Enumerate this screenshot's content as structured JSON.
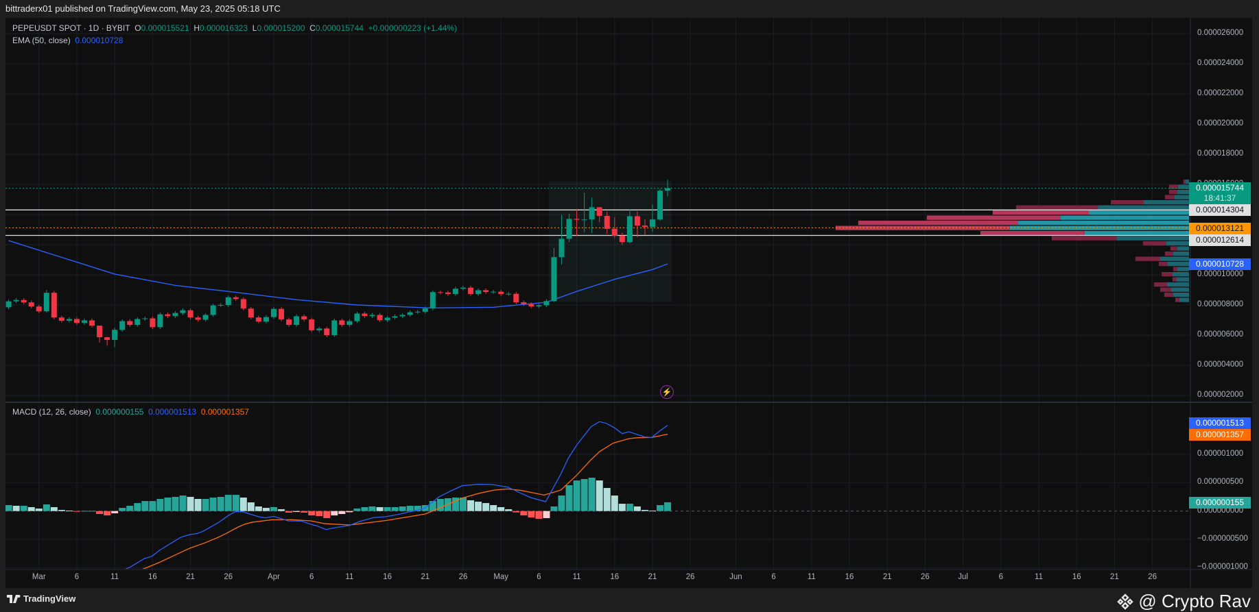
{
  "header": {
    "published": "bittraderx01 published on TradingView.com, May 23, 2025 05:18 UTC"
  },
  "legend": {
    "symbol": "PEPEUSDT SPOT · 1D · BYBIT",
    "o_label": "O",
    "o": "0.000015521",
    "h_label": "H",
    "h": "0.000016323",
    "l_label": "L",
    "l": "0.000015200",
    "c_label": "C",
    "c": "0.000015744",
    "change": "+0.000000223 (+1.44%)",
    "ema_label": "EMA (50, close)",
    "ema_value": "0.000010728",
    "macd_label": "MACD (12, 26, close)",
    "macd_hist": "0.000000155",
    "macd_line": "0.000001513",
    "macd_signal": "0.000001357"
  },
  "markers": {
    "price": "0.000015744",
    "countdown": "18:41:37",
    "level_high": "0.000014304",
    "poc": "0.000013121",
    "level_low": "0.000012614",
    "ema": "0.000010728",
    "macd_line": "0.000001513",
    "macd_signal": "0.000001357",
    "macd_hist": "0.000000155"
  },
  "footer": {
    "brand": "TradingView",
    "watermark": "@ Crypto Rav"
  },
  "colors": {
    "up": "#089981",
    "down": "#f23645",
    "ema": "#2962ff",
    "signal": "#ff6d00",
    "poc": "#ff9800",
    "hist_up": "#26a69a",
    "hist_up_light": "#b2dfdb",
    "hist_down": "#ff5252",
    "hist_down_light": "#ffcdd2"
  },
  "chart_data": {
    "type": "candlestick",
    "symbol": "PEPEUSDT",
    "unit": "1e-6 USDT",
    "start_date": "2025-02-25",
    "first_open": 7.85,
    "closes": [
      8.24,
      8.33,
      8.17,
      7.9,
      7.58,
      8.81,
      7.17,
      6.95,
      7.07,
      6.81,
      6.98,
      6.63,
      5.86,
      5.68,
      6.35,
      6.93,
      6.68,
      7.07,
      7.11,
      6.53,
      7.38,
      7.26,
      7.47,
      7.65,
      7.17,
      7.02,
      7.34,
      7.97,
      8.0,
      8.51,
      8.39,
      7.76,
      7.17,
      6.9,
      7.2,
      7.74,
      7.04,
      6.68,
      7.25,
      7.04,
      6.32,
      6.44,
      6.0,
      6.98,
      6.68,
      6.93,
      7.43,
      7.26,
      7.34,
      6.99,
      7.16,
      7.25,
      7.34,
      7.52,
      7.55,
      7.77,
      8.85,
      8.83,
      8.73,
      9.08,
      9.15,
      8.73,
      8.98,
      8.86,
      8.88,
      8.73,
      8.74,
      8.18,
      8.05,
      7.91,
      7.98,
      8.26,
      11.17,
      12.39,
      13.71,
      13.65,
      13.67,
      14.48,
      13.91,
      13.05,
      12.59,
      12.17,
      13.89,
      13.27,
      13.18,
      13.67,
      15.58,
      15.744
    ],
    "wick_overrides": {
      "5": [
        9.0,
        7.5
      ],
      "12": [
        6.6,
        5.5
      ],
      "13": [
        5.9,
        5.3
      ],
      "14": [
        6.5,
        5.2
      ],
      "72": [
        11.79,
        8.2
      ],
      "73": [
        13.98,
        10.68
      ],
      "74": [
        14.06,
        12.17
      ],
      "75": [
        14.32,
        12.58
      ],
      "76": [
        15.45,
        12.82
      ],
      "77": [
        15.12,
        12.77
      ],
      "78": [
        14.5,
        13.48
      ],
      "79": [
        14.2,
        12.73
      ],
      "80": [
        13.83,
        12.45
      ],
      "81": [
        12.8,
        11.98
      ],
      "82": [
        14.32,
        12.1
      ],
      "83": [
        14.2,
        12.5
      ],
      "84": [
        13.67,
        12.67
      ],
      "85": [
        14.67,
        12.85
      ],
      "86": [
        15.7,
        13.6
      ],
      "87": [
        16.323,
        15.2
      ]
    },
    "ema50": [
      [
        0,
        12.27
      ],
      [
        8,
        11.0
      ],
      [
        14,
        10.05
      ],
      [
        22,
        9.3
      ],
      [
        30,
        8.84
      ],
      [
        38,
        8.35
      ],
      [
        46,
        8.0
      ],
      [
        56,
        7.8
      ],
      [
        64,
        7.85
      ],
      [
        71,
        8.18
      ],
      [
        75,
        8.9
      ],
      [
        80,
        9.7
      ],
      [
        85,
        10.35
      ],
      [
        87,
        10.728
      ]
    ],
    "levels": {
      "resistance": 14.304,
      "poc": 13.121,
      "support": 12.614,
      "last": 15.744
    },
    "range_box": {
      "from_index": 72,
      "to_index": 87,
      "top": 16.2,
      "bottom": 8.2
    },
    "price_ticks": [
      2,
      4,
      6,
      8,
      10,
      12,
      14,
      16,
      18,
      20,
      22,
      24,
      26
    ],
    "price_tick_labels": [
      "0.000002000",
      "0.000004000",
      "0.000006000",
      "0.000008000",
      "0.000010000",
      "0.000012000",
      "0.000014000",
      "0.000016000",
      "0.000018000",
      "0.000020000",
      "0.000022000",
      "0.000024000",
      "0.000026000"
    ],
    "volume_profile": {
      "top_price": 16.4,
      "row_step_price": 0.34,
      "value_area_rows": [
        6,
        7,
        8,
        9,
        10
      ],
      "rows": [
        [
          24,
          15
        ],
        [
          85,
          47
        ],
        [
          85,
          50
        ],
        [
          102,
          61
        ],
        [
          331,
          192
        ],
        [
          732,
          385
        ],
        [
          831,
          424
        ],
        [
          1110,
          543
        ],
        [
          1400,
          723
        ],
        [
          1496,
          758
        ],
        [
          883,
          442
        ],
        [
          581,
          305
        ],
        [
          195,
          96
        ],
        [
          79,
          50
        ],
        [
          102,
          67
        ],
        [
          227,
          122
        ],
        [
          128,
          90
        ],
        [
          67,
          50
        ],
        [
          116,
          70
        ],
        [
          70,
          53
        ],
        [
          148,
          93
        ],
        [
          122,
          76
        ],
        [
          105,
          67
        ],
        [
          58,
          41
        ]
      ]
    },
    "macd_unit": "1e-7",
    "macd_ticks": [
      10,
      5,
      0,
      -5,
      -10
    ],
    "macd_tick_labels": [
      "0.000001000",
      "0.000000500",
      "0.000000000",
      "−0.000000500",
      "−0.000001000"
    ],
    "macd_hist": [
      1.05,
      0.93,
      0.93,
      0.69,
      0.44,
      1.17,
      0.69,
      0.2,
      0.08,
      -0.12,
      0.04,
      0.04,
      -0.52,
      -0.77,
      -0.4,
      0.56,
      0.93,
      1.41,
      1.77,
      1.77,
      2.14,
      2.38,
      2.5,
      2.74,
      2.5,
      2.14,
      2.14,
      2.38,
      2.5,
      2.86,
      2.86,
      2.38,
      1.53,
      0.81,
      0.56,
      0.69,
      0.32,
      -0.28,
      -0.16,
      -0.28,
      -0.77,
      -0.89,
      -1.25,
      -0.77,
      -0.52,
      -0.2,
      0.44,
      0.69,
      0.81,
      0.69,
      0.69,
      0.69,
      0.81,
      0.93,
      0.93,
      1.05,
      1.77,
      2.14,
      2.26,
      2.38,
      2.38,
      1.9,
      1.65,
      1.41,
      1.05,
      0.69,
      0.32,
      -0.24,
      -0.77,
      -1.13,
      -1.37,
      -1.25,
      0.81,
      2.74,
      4.56,
      5.4,
      5.65,
      5.89,
      5.4,
      4.07,
      2.74,
      1.29,
      1.29,
      0.81,
      0.2,
      0.08,
      1.05,
      1.55
    ],
    "macd_line": [
      [
        0,
        -16
      ],
      [
        10,
        -13
      ],
      [
        15.9,
        -10
      ],
      [
        17.9,
        -8.39
      ],
      [
        18.9,
        -7.98
      ],
      [
        20,
        -6.85
      ],
      [
        22.7,
        -4.64
      ],
      [
        23.9,
        -4.15
      ],
      [
        24.8,
        -4.0
      ],
      [
        25.7,
        -3.55
      ],
      [
        27.8,
        -1.94
      ],
      [
        29,
        -0.8
      ],
      [
        29.9,
        -0.12
      ],
      [
        30.9,
        -0.12
      ],
      [
        33,
        -1.0
      ],
      [
        33.9,
        -1.2
      ],
      [
        35,
        -0.93
      ],
      [
        36.9,
        -1.73
      ],
      [
        38.7,
        -1.77
      ],
      [
        39.9,
        -2.34
      ],
      [
        40.8,
        -2.66
      ],
      [
        41.9,
        -3.27
      ],
      [
        42.9,
        -2.98
      ],
      [
        45,
        -2.54
      ],
      [
        46.3,
        -1.85
      ],
      [
        48.1,
        -1.17
      ],
      [
        49.9,
        -0.97
      ],
      [
        51.7,
        -0.52
      ],
      [
        53.5,
        0.04
      ],
      [
        54.9,
        0.48
      ],
      [
        56.8,
        2.5
      ],
      [
        58.6,
        3.7
      ],
      [
        59.9,
        4.48
      ],
      [
        62,
        4.72
      ],
      [
        63.8,
        4.68
      ],
      [
        65.9,
        4.23
      ],
      [
        67.7,
        3.1
      ],
      [
        68.9,
        2.38
      ],
      [
        70.9,
        1.65
      ],
      [
        72.9,
        6.53
      ],
      [
        73.9,
        9.35
      ],
      [
        75,
        11.65
      ],
      [
        76.9,
        14.9
      ],
      [
        78,
        15.77
      ],
      [
        78.9,
        15.48
      ],
      [
        80,
        14.68
      ],
      [
        81,
        13.67
      ],
      [
        81.9,
        13.99
      ],
      [
        84,
        13.06
      ],
      [
        84.9,
        12.98
      ],
      [
        86,
        14.19
      ],
      [
        87,
        15.13
      ]
    ],
    "macd_signal": [
      [
        0,
        -17
      ],
      [
        10,
        -14
      ],
      [
        18.2,
        -10
      ],
      [
        20,
        -9.0
      ],
      [
        22.7,
        -7.3
      ],
      [
        23.9,
        -6.57
      ],
      [
        26,
        -5.56
      ],
      [
        27.8,
        -4.56
      ],
      [
        29,
        -3.75
      ],
      [
        30.3,
        -2.82
      ],
      [
        31.2,
        -2.3
      ],
      [
        32.1,
        -1.98
      ],
      [
        34.8,
        -1.53
      ],
      [
        37.5,
        -1.53
      ],
      [
        39.9,
        -1.73
      ],
      [
        41.7,
        -2.22
      ],
      [
        45,
        -2.46
      ],
      [
        49.9,
        -1.65
      ],
      [
        55,
        -0.52
      ],
      [
        56.8,
        0.48
      ],
      [
        59.9,
        2.3
      ],
      [
        62,
        3.1
      ],
      [
        64.1,
        3.7
      ],
      [
        65.9,
        3.91
      ],
      [
        67.7,
        3.63
      ],
      [
        70.7,
        2.82
      ],
      [
        72.9,
        3.7
      ],
      [
        75,
        6.33
      ],
      [
        76.8,
        8.95
      ],
      [
        78,
        10.48
      ],
      [
        79.8,
        11.98
      ],
      [
        81.9,
        12.78
      ],
      [
        83,
        12.94
      ],
      [
        84.9,
        12.98
      ],
      [
        87,
        13.57
      ]
    ],
    "x_ticks": [
      {
        "date": "2025-03-01",
        "label": "Mar"
      },
      {
        "date": "2025-03-06",
        "label": "6"
      },
      {
        "date": "2025-03-11",
        "label": "11"
      },
      {
        "date": "2025-03-16",
        "label": "16"
      },
      {
        "date": "2025-03-21",
        "label": "21"
      },
      {
        "date": "2025-03-26",
        "label": "26"
      },
      {
        "date": "2025-04-01",
        "label": "Apr"
      },
      {
        "date": "2025-04-06",
        "label": "6"
      },
      {
        "date": "2025-04-11",
        "label": "11"
      },
      {
        "date": "2025-04-16",
        "label": "16"
      },
      {
        "date": "2025-04-21",
        "label": "21"
      },
      {
        "date": "2025-04-26",
        "label": "26"
      },
      {
        "date": "2025-05-01",
        "label": "May"
      },
      {
        "date": "2025-05-06",
        "label": "6"
      },
      {
        "date": "2025-05-11",
        "label": "11"
      },
      {
        "date": "2025-05-16",
        "label": "16"
      },
      {
        "date": "2025-05-21",
        "label": "21"
      },
      {
        "date": "2025-05-26",
        "label": "26"
      },
      {
        "date": "2025-06-01",
        "label": "Jun"
      },
      {
        "date": "2025-06-06",
        "label": "6"
      },
      {
        "date": "2025-06-11",
        "label": "11"
      },
      {
        "date": "2025-06-16",
        "label": "16"
      },
      {
        "date": "2025-06-21",
        "label": "21"
      },
      {
        "date": "2025-06-26",
        "label": "26"
      },
      {
        "date": "2025-07-01",
        "label": "Jul"
      },
      {
        "date": "2025-07-06",
        "label": "6"
      },
      {
        "date": "2025-07-11",
        "label": "11"
      },
      {
        "date": "2025-07-16",
        "label": "16"
      },
      {
        "date": "2025-07-21",
        "label": "21"
      },
      {
        "date": "2025-07-26",
        "label": "26"
      }
    ]
  }
}
